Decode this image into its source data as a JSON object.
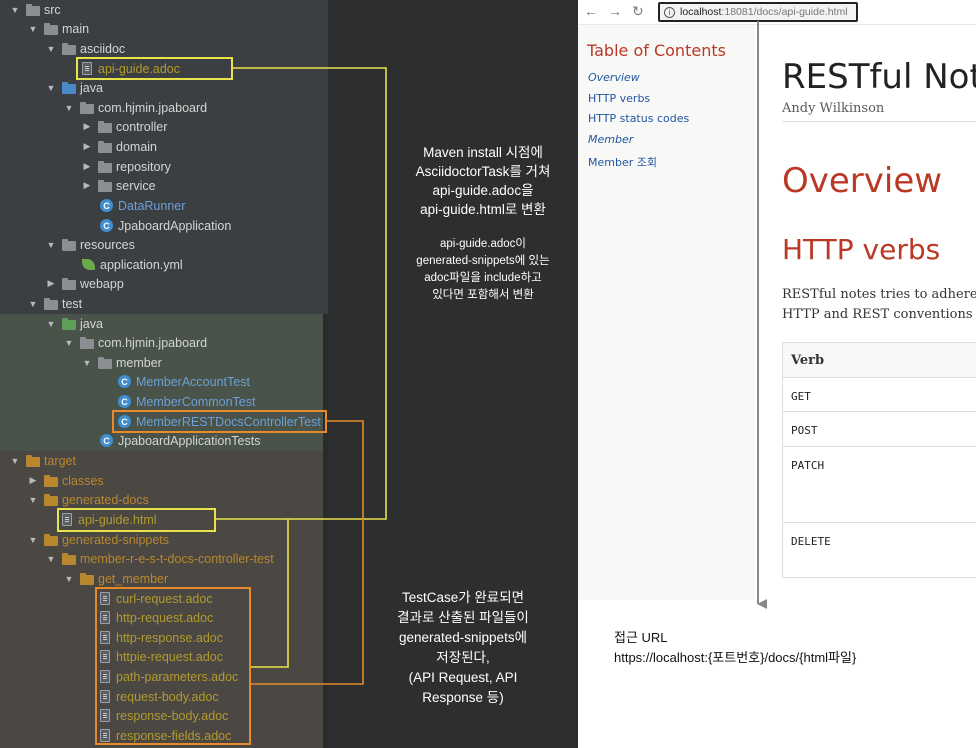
{
  "tree": {
    "rows": [
      {
        "label": "src"
      },
      {
        "label": "main"
      },
      {
        "label": "asciidoc"
      },
      {
        "label": "api-guide.adoc"
      },
      {
        "label": "java"
      },
      {
        "label": "com.hjmin.jpaboard"
      },
      {
        "label": "controller"
      },
      {
        "label": "domain"
      },
      {
        "label": "repository"
      },
      {
        "label": "service"
      },
      {
        "label": "DataRunner"
      },
      {
        "label": "JpaboardApplication"
      },
      {
        "label": "resources"
      },
      {
        "label": "application.yml"
      },
      {
        "label": "webapp"
      },
      {
        "label": "test"
      },
      {
        "label": "java"
      },
      {
        "label": "com.hjmin.jpaboard"
      },
      {
        "label": "member"
      },
      {
        "label": "MemberAccountTest"
      },
      {
        "label": "MemberCommonTest"
      },
      {
        "label": "MemberRESTDocsControllerTest"
      },
      {
        "label": "JpaboardApplicationTests"
      },
      {
        "label": "target"
      },
      {
        "label": "classes"
      },
      {
        "label": "generated-docs"
      },
      {
        "label": "api-guide.html"
      },
      {
        "label": "generated-snippets"
      },
      {
        "label": "member-r-e-s-t-docs-controller-test"
      },
      {
        "label": "get_member"
      },
      {
        "label": "curl-request.adoc"
      },
      {
        "label": "http-request.adoc"
      },
      {
        "label": "http-response.adoc"
      },
      {
        "label": "httpie-request.adoc"
      },
      {
        "label": "path-parameters.adoc"
      },
      {
        "label": "request-body.adoc"
      },
      {
        "label": "response-body.adoc"
      },
      {
        "label": "response-fields.adoc"
      }
    ]
  },
  "annotations": {
    "build": {
      "lines": [
        "Maven install 시점에",
        "AsciidoctorTask를 거쳐",
        "api-guide.adoc을",
        "api-guide.html로 변환"
      ]
    },
    "include": {
      "lines": [
        "api-guide.adoc이",
        "generated-snippets에 있는",
        "adoc파일을 include하고",
        "있다면 포함해서 변환"
      ]
    },
    "testcase": {
      "lines": [
        "TestCase가 완료되면",
        "결과로 산출된 파일들이",
        "generated-snippets에",
        "저장된다,",
        "(API Request, API",
        "Response 등)"
      ]
    },
    "access": {
      "lines": [
        "접근 URL",
        "https://localhost:{포트번호}/docs/{html파일}"
      ]
    }
  },
  "browser": {
    "url_host": "localhost",
    "url_path": ":18081/docs/api-guide.html",
    "toc": {
      "title": "Table of Contents",
      "items": [
        "Overview",
        "HTTP verbs",
        "HTTP status codes",
        "Member",
        "Member 조회"
      ]
    },
    "doc": {
      "title": "RESTful Note",
      "author": "Andy Wilkinson",
      "h_overview": "Overview",
      "h_verbs": "HTTP verbs",
      "para1": "RESTful notes tries to adhere a",
      "para2": "HTTP and REST conventions in",
      "table_header": "Verb",
      "verbs": [
        "GET",
        "POST",
        "PATCH",
        "DELETE"
      ]
    }
  },
  "colors": {
    "yellow_highlight": "#e8e34a",
    "orange_highlight": "#e58b2c",
    "asciidoc_red": "#ba3925"
  }
}
